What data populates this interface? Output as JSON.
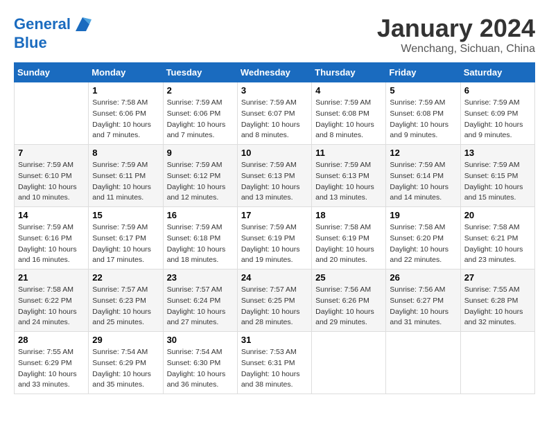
{
  "header": {
    "logo_line1": "General",
    "logo_line2": "Blue",
    "month_title": "January 2024",
    "location": "Wenchang, Sichuan, China"
  },
  "weekdays": [
    "Sunday",
    "Monday",
    "Tuesday",
    "Wednesday",
    "Thursday",
    "Friday",
    "Saturday"
  ],
  "weeks": [
    [
      {
        "day": "",
        "sunrise": "",
        "sunset": "",
        "daylight": ""
      },
      {
        "day": "1",
        "sunrise": "Sunrise: 7:58 AM",
        "sunset": "Sunset: 6:06 PM",
        "daylight": "Daylight: 10 hours and 7 minutes."
      },
      {
        "day": "2",
        "sunrise": "Sunrise: 7:59 AM",
        "sunset": "Sunset: 6:06 PM",
        "daylight": "Daylight: 10 hours and 7 minutes."
      },
      {
        "day": "3",
        "sunrise": "Sunrise: 7:59 AM",
        "sunset": "Sunset: 6:07 PM",
        "daylight": "Daylight: 10 hours and 8 minutes."
      },
      {
        "day": "4",
        "sunrise": "Sunrise: 7:59 AM",
        "sunset": "Sunset: 6:08 PM",
        "daylight": "Daylight: 10 hours and 8 minutes."
      },
      {
        "day": "5",
        "sunrise": "Sunrise: 7:59 AM",
        "sunset": "Sunset: 6:08 PM",
        "daylight": "Daylight: 10 hours and 9 minutes."
      },
      {
        "day": "6",
        "sunrise": "Sunrise: 7:59 AM",
        "sunset": "Sunset: 6:09 PM",
        "daylight": "Daylight: 10 hours and 9 minutes."
      }
    ],
    [
      {
        "day": "7",
        "sunrise": "Sunrise: 7:59 AM",
        "sunset": "Sunset: 6:10 PM",
        "daylight": "Daylight: 10 hours and 10 minutes."
      },
      {
        "day": "8",
        "sunrise": "Sunrise: 7:59 AM",
        "sunset": "Sunset: 6:11 PM",
        "daylight": "Daylight: 10 hours and 11 minutes."
      },
      {
        "day": "9",
        "sunrise": "Sunrise: 7:59 AM",
        "sunset": "Sunset: 6:12 PM",
        "daylight": "Daylight: 10 hours and 12 minutes."
      },
      {
        "day": "10",
        "sunrise": "Sunrise: 7:59 AM",
        "sunset": "Sunset: 6:13 PM",
        "daylight": "Daylight: 10 hours and 13 minutes."
      },
      {
        "day": "11",
        "sunrise": "Sunrise: 7:59 AM",
        "sunset": "Sunset: 6:13 PM",
        "daylight": "Daylight: 10 hours and 13 minutes."
      },
      {
        "day": "12",
        "sunrise": "Sunrise: 7:59 AM",
        "sunset": "Sunset: 6:14 PM",
        "daylight": "Daylight: 10 hours and 14 minutes."
      },
      {
        "day": "13",
        "sunrise": "Sunrise: 7:59 AM",
        "sunset": "Sunset: 6:15 PM",
        "daylight": "Daylight: 10 hours and 15 minutes."
      }
    ],
    [
      {
        "day": "14",
        "sunrise": "Sunrise: 7:59 AM",
        "sunset": "Sunset: 6:16 PM",
        "daylight": "Daylight: 10 hours and 16 minutes."
      },
      {
        "day": "15",
        "sunrise": "Sunrise: 7:59 AM",
        "sunset": "Sunset: 6:17 PM",
        "daylight": "Daylight: 10 hours and 17 minutes."
      },
      {
        "day": "16",
        "sunrise": "Sunrise: 7:59 AM",
        "sunset": "Sunset: 6:18 PM",
        "daylight": "Daylight: 10 hours and 18 minutes."
      },
      {
        "day": "17",
        "sunrise": "Sunrise: 7:59 AM",
        "sunset": "Sunset: 6:19 PM",
        "daylight": "Daylight: 10 hours and 19 minutes."
      },
      {
        "day": "18",
        "sunrise": "Sunrise: 7:58 AM",
        "sunset": "Sunset: 6:19 PM",
        "daylight": "Daylight: 10 hours and 20 minutes."
      },
      {
        "day": "19",
        "sunrise": "Sunrise: 7:58 AM",
        "sunset": "Sunset: 6:20 PM",
        "daylight": "Daylight: 10 hours and 22 minutes."
      },
      {
        "day": "20",
        "sunrise": "Sunrise: 7:58 AM",
        "sunset": "Sunset: 6:21 PM",
        "daylight": "Daylight: 10 hours and 23 minutes."
      }
    ],
    [
      {
        "day": "21",
        "sunrise": "Sunrise: 7:58 AM",
        "sunset": "Sunset: 6:22 PM",
        "daylight": "Daylight: 10 hours and 24 minutes."
      },
      {
        "day": "22",
        "sunrise": "Sunrise: 7:57 AM",
        "sunset": "Sunset: 6:23 PM",
        "daylight": "Daylight: 10 hours and 25 minutes."
      },
      {
        "day": "23",
        "sunrise": "Sunrise: 7:57 AM",
        "sunset": "Sunset: 6:24 PM",
        "daylight": "Daylight: 10 hours and 27 minutes."
      },
      {
        "day": "24",
        "sunrise": "Sunrise: 7:57 AM",
        "sunset": "Sunset: 6:25 PM",
        "daylight": "Daylight: 10 hours and 28 minutes."
      },
      {
        "day": "25",
        "sunrise": "Sunrise: 7:56 AM",
        "sunset": "Sunset: 6:26 PM",
        "daylight": "Daylight: 10 hours and 29 minutes."
      },
      {
        "day": "26",
        "sunrise": "Sunrise: 7:56 AM",
        "sunset": "Sunset: 6:27 PM",
        "daylight": "Daylight: 10 hours and 31 minutes."
      },
      {
        "day": "27",
        "sunrise": "Sunrise: 7:55 AM",
        "sunset": "Sunset: 6:28 PM",
        "daylight": "Daylight: 10 hours and 32 minutes."
      }
    ],
    [
      {
        "day": "28",
        "sunrise": "Sunrise: 7:55 AM",
        "sunset": "Sunset: 6:29 PM",
        "daylight": "Daylight: 10 hours and 33 minutes."
      },
      {
        "day": "29",
        "sunrise": "Sunrise: 7:54 AM",
        "sunset": "Sunset: 6:29 PM",
        "daylight": "Daylight: 10 hours and 35 minutes."
      },
      {
        "day": "30",
        "sunrise": "Sunrise: 7:54 AM",
        "sunset": "Sunset: 6:30 PM",
        "daylight": "Daylight: 10 hours and 36 minutes."
      },
      {
        "day": "31",
        "sunrise": "Sunrise: 7:53 AM",
        "sunset": "Sunset: 6:31 PM",
        "daylight": "Daylight: 10 hours and 38 minutes."
      },
      {
        "day": "",
        "sunrise": "",
        "sunset": "",
        "daylight": ""
      },
      {
        "day": "",
        "sunrise": "",
        "sunset": "",
        "daylight": ""
      },
      {
        "day": "",
        "sunrise": "",
        "sunset": "",
        "daylight": ""
      }
    ]
  ]
}
